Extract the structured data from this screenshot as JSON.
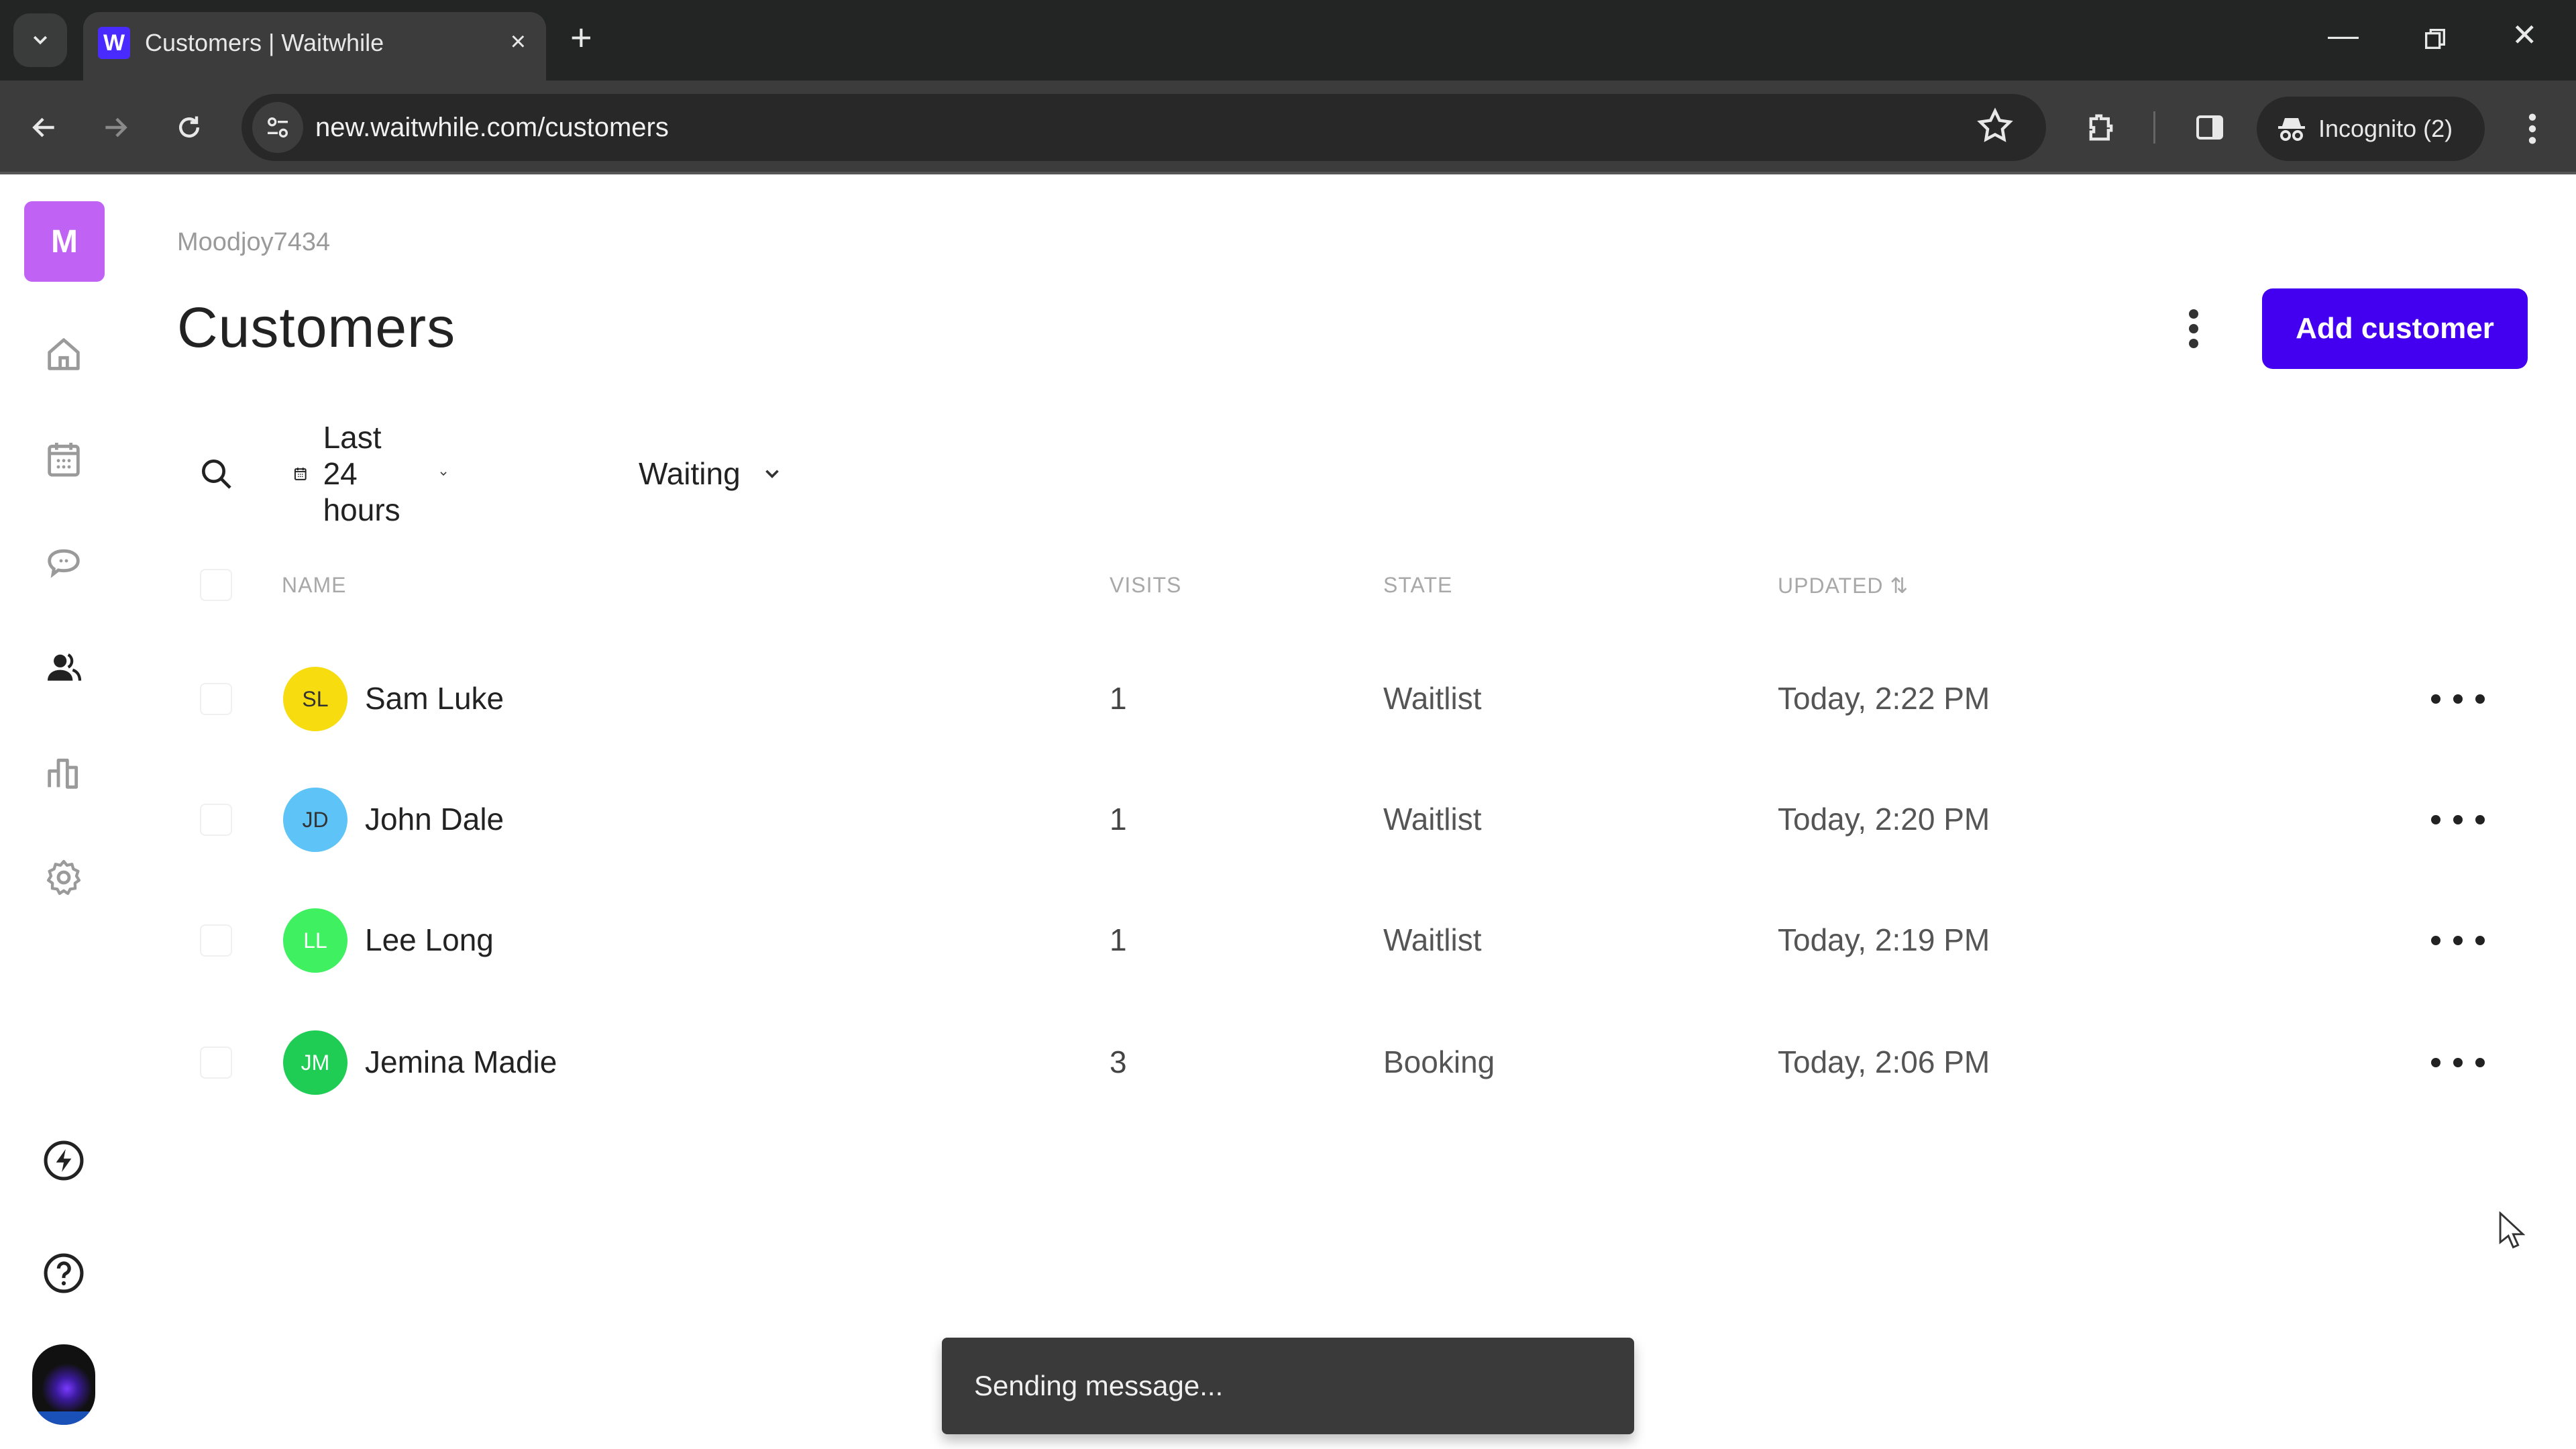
{
  "browser": {
    "tab_title": "Customers | Waitwhile",
    "favicon_letter": "W",
    "url": "new.waitwhile.com/customers",
    "incognito_label": "Incognito (2)",
    "new_tab_symbol": "+",
    "close_tab_symbol": "×",
    "minimize_symbol": "—",
    "close_window_symbol": "✕"
  },
  "sidebar": {
    "org_initial": "M",
    "org_color": "#c063f5",
    "items": [
      {
        "name": "home",
        "icon": "home-icon",
        "active": false
      },
      {
        "name": "calendar",
        "icon": "calendar-icon",
        "active": false
      },
      {
        "name": "messages",
        "icon": "chat-icon",
        "active": false
      },
      {
        "name": "customers",
        "icon": "customers-icon",
        "active": true
      },
      {
        "name": "analytics",
        "icon": "bar-chart-icon",
        "active": false
      },
      {
        "name": "settings",
        "icon": "gear-icon",
        "active": false
      }
    ],
    "bottom_items": [
      {
        "name": "whats-new",
        "icon": "lightning-icon"
      },
      {
        "name": "help",
        "icon": "help-icon"
      },
      {
        "name": "profile",
        "icon": "user-photo"
      }
    ]
  },
  "header": {
    "breadcrumb": "Moodjoy7434",
    "title": "Customers",
    "add_button_label": "Add customer",
    "accent_color": "#4300f0"
  },
  "filters": {
    "date_range": "Last 24 hours",
    "state": "Waiting"
  },
  "table": {
    "columns": {
      "name": "NAME",
      "visits": "VISITS",
      "state": "STATE",
      "updated": "UPDATED ⇅"
    },
    "rows": [
      {
        "initials": "SL",
        "name": "Sam Luke",
        "visits": "1",
        "state": "Waitlist",
        "updated": "Today, 2:22 PM",
        "avatar_color": "#f7dc10",
        "initials_color": "#333333"
      },
      {
        "initials": "JD",
        "name": "John Dale",
        "visits": "1",
        "state": "Waitlist",
        "updated": "Today, 2:20 PM",
        "avatar_color": "#5ec3f7",
        "initials_color": "#333333"
      },
      {
        "initials": "LL",
        "name": "Lee Long",
        "visits": "1",
        "state": "Waitlist",
        "updated": "Today, 2:19 PM",
        "avatar_color": "#3ff060",
        "initials_color": "#ffffff"
      },
      {
        "initials": "JM",
        "name": "Jemina Madie",
        "visits": "3",
        "state": "Booking",
        "updated": "Today, 2:06 PM",
        "avatar_color": "#1fcd55",
        "initials_color": "#ffffff"
      }
    ]
  },
  "toast": {
    "message": "Sending message..."
  }
}
